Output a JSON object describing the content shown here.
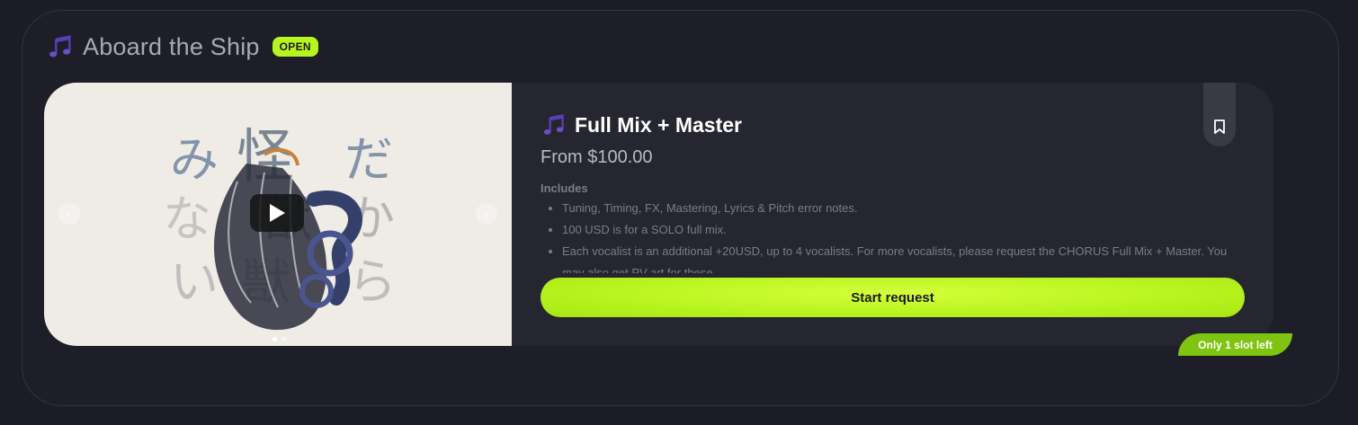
{
  "section": {
    "icon": "music-note-icon",
    "title": "Aboard the Ship",
    "status_badge": "OPEN"
  },
  "service": {
    "icon": "music-note-icon",
    "title": "Full Mix + Master",
    "price": "From $100.00",
    "includes_label": "Includes",
    "includes": [
      "Tuning, Timing, FX, Mastering, Lyrics & Pitch error notes.",
      "100 USD is for a SOLO full mix.",
      "Each vocalist is an additional +20USD, up to 4 vocalists. For more vocalists, please request the CHORUS Full Mix + Master. You may also get PV art for these."
    ],
    "cta_label": "Start request",
    "availability": "Only 1 slot left",
    "bookmark_icon": "bookmark-icon"
  },
  "media": {
    "artwork_text": [
      "み",
      "怪",
      "だ",
      "な",
      "獣",
      "か",
      "い",
      "獣",
      "ら"
    ],
    "play_icon": "play-icon",
    "prev_icon": "chevron-left-icon",
    "next_icon": "chevron-right-icon",
    "slide_count": 2,
    "active_slide": 1
  },
  "colors": {
    "background": "#1c1c26",
    "card": "#262631",
    "accent": "#b6f51d",
    "slot_badge": "#7ec410",
    "note_icon": "#6b4fc8"
  }
}
